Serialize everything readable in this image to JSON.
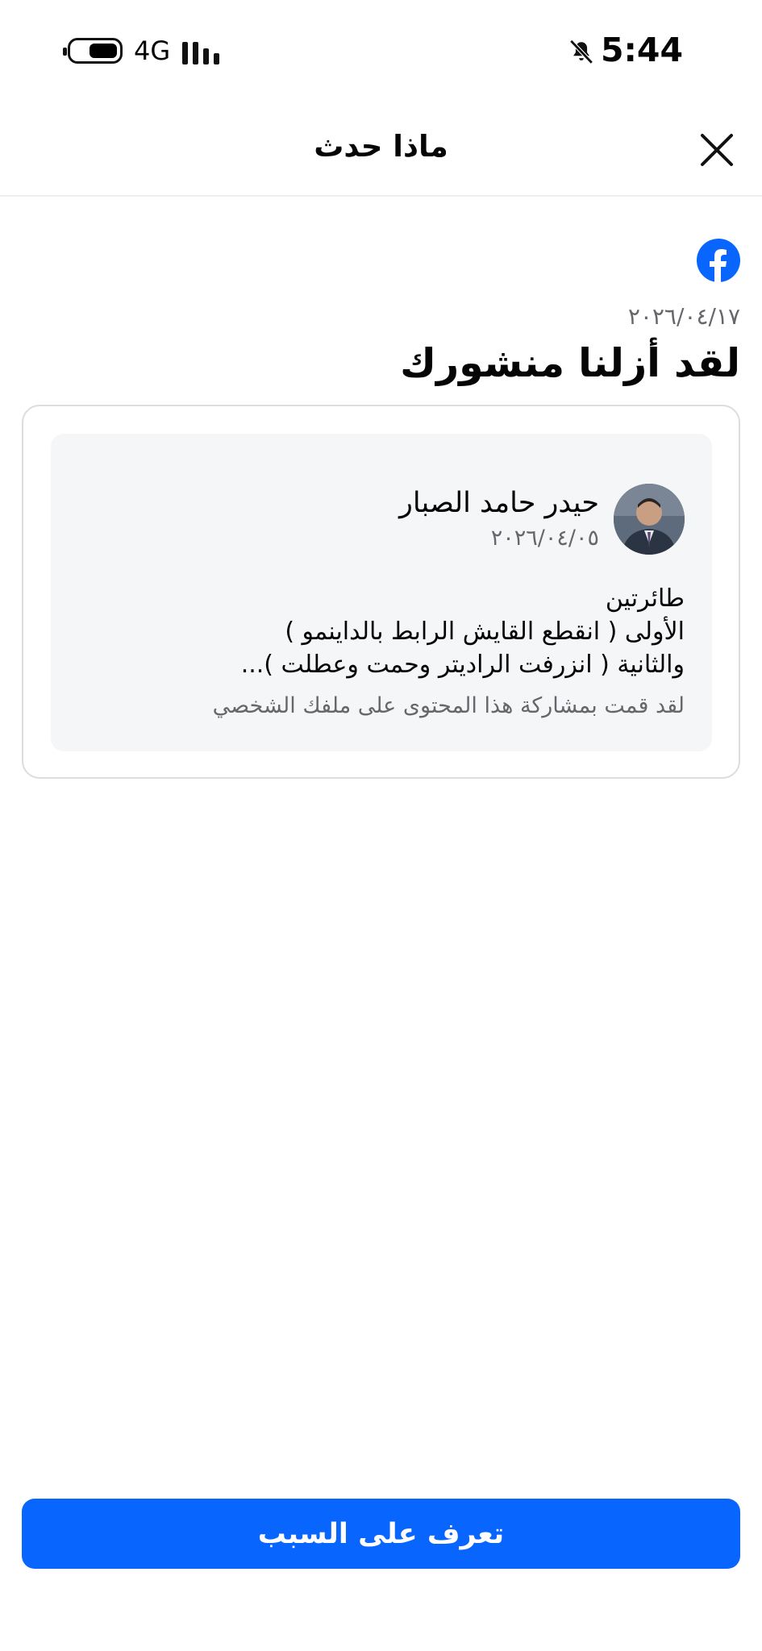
{
  "status_bar": {
    "time": "5:44",
    "network": "4G",
    "icons": [
      "battery-icon",
      "signal-icon",
      "bell-off-icon"
    ]
  },
  "header": {
    "title": "ماذا حدث",
    "close_icon": "close-icon"
  },
  "notice": {
    "date": "٢٠٢٦/٠٤/١٧",
    "title": "لقد أزلنا منشورك",
    "logo_icon": "facebook-logo-icon"
  },
  "post": {
    "author": "حيدر حامد الصبار",
    "date": "٢٠٢٦/٠٤/٠٥",
    "lines": [
      "طائرتين",
      "الأولى ( انقطع القايش الرابط بالداينمو )",
      "والثانية ( انزرفت الراديتر وحمت وعطلت )..."
    ],
    "note": "لقد قمت بمشاركة هذا المحتوى على ملفك الشخصي"
  },
  "action": {
    "button_label": "تعرف على السبب"
  },
  "colors": {
    "accent": "#0866ff",
    "muted_text": "#65676b",
    "card_bg": "#f5f6f8",
    "border": "#dadde1"
  }
}
